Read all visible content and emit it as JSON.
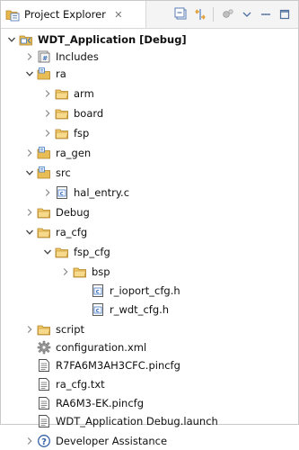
{
  "view": {
    "tab_title": "Project Explorer",
    "tab_close_glyph": "✕"
  },
  "toolbar": {
    "buttons": [
      {
        "name": "collapse-all-button",
        "icon": "collapse-all-icon"
      },
      {
        "name": "link-with-editor-button",
        "icon": "link-with-editor-icon"
      },
      {
        "name": "focus-button",
        "icon": "focus-icon"
      },
      {
        "name": "view-menu-button",
        "icon": "chevron-down-icon"
      },
      {
        "name": "minimize-button",
        "icon": "minimize-icon"
      },
      {
        "name": "maximize-button",
        "icon": "maximize-icon"
      }
    ]
  },
  "tree": [
    {
      "label": "WDT_Application [Debug]",
      "icon": "project-icon",
      "expander": "expanded",
      "bold": true
    },
    {
      "label": "Includes",
      "icon": "includes-icon",
      "expander": "collapsed"
    },
    {
      "label": "ra",
      "icon": "source-folder-icon",
      "expander": "expanded"
    },
    {
      "label": "arm",
      "icon": "folder-icon",
      "expander": "collapsed"
    },
    {
      "label": "board",
      "icon": "folder-icon",
      "expander": "collapsed"
    },
    {
      "label": "fsp",
      "icon": "folder-icon",
      "expander": "collapsed"
    },
    {
      "label": "ra_gen",
      "icon": "source-folder-icon",
      "expander": "collapsed"
    },
    {
      "label": "src",
      "icon": "source-folder-icon",
      "expander": "expanded"
    },
    {
      "label": "hal_entry.c",
      "icon": "c-file-icon",
      "expander": "collapsed"
    },
    {
      "label": "Debug",
      "icon": "folder-icon",
      "expander": "collapsed"
    },
    {
      "label": "ra_cfg",
      "icon": "folder-icon",
      "expander": "expanded"
    },
    {
      "label": "fsp_cfg",
      "icon": "folder-icon",
      "expander": "expanded"
    },
    {
      "label": "bsp",
      "icon": "folder-icon",
      "expander": "collapsed"
    },
    {
      "label": "r_ioport_cfg.h",
      "icon": "h-file-icon",
      "expander": "none"
    },
    {
      "label": "r_wdt_cfg.h",
      "icon": "h-file-icon",
      "expander": "none"
    },
    {
      "label": "script",
      "icon": "folder-icon",
      "expander": "collapsed"
    },
    {
      "label": "configuration.xml",
      "icon": "configuration-gear-icon",
      "expander": "none"
    },
    {
      "label": "R7FA6M3AH3CFC.pincfg",
      "icon": "text-file-icon",
      "expander": "none"
    },
    {
      "label": "ra_cfg.txt",
      "icon": "text-file-icon",
      "expander": "none"
    },
    {
      "label": "RA6M3-EK.pincfg",
      "icon": "text-file-icon",
      "expander": "none"
    },
    {
      "label": "WDT_Application Debug.launch",
      "icon": "text-file-icon",
      "expander": "none"
    },
    {
      "label": "Developer Assistance",
      "icon": "help-circle-icon",
      "expander": "collapsed"
    }
  ]
}
